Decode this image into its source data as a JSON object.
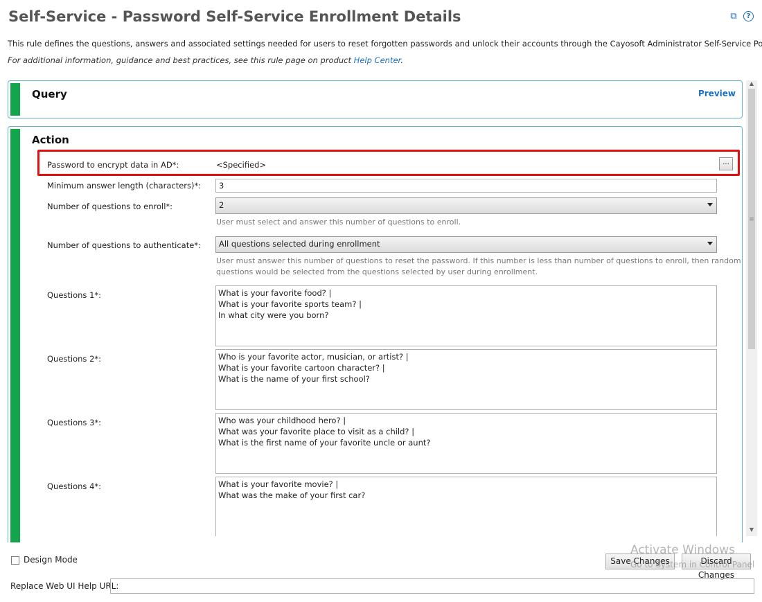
{
  "header": {
    "title": "Self-Service - Password Self-Service Enrollment Details",
    "copy_icon": "copy-icon",
    "help_icon": "help-icon",
    "description": "This rule defines the questions, answers and associated settings needed for users to reset forgotten passwords and unlock their accounts through the Cayosoft Administrator Self-Service Portal.",
    "help_prefix": "For additional information, guidance and best practices, see this rule page on product ",
    "help_link": "Help Center",
    "help_suffix": "."
  },
  "query": {
    "title": "Query",
    "preview_label": "Preview"
  },
  "action": {
    "title": "Action",
    "password_label": "Password to encrypt data in AD*:",
    "password_value": "<Specified>",
    "ellipsis_label": "...",
    "min_length_label": "Minimum answer length (characters)*:",
    "min_length_value": "3",
    "enroll_label": "Number of questions to enroll*:",
    "enroll_value": "2",
    "enroll_hint": "User must select and answer this number of questions to enroll.",
    "auth_label": "Number of questions to authenticate*:",
    "auth_value": "All questions selected during enrollment",
    "auth_hint_1": "User must answer this number of questions to reset the password. If this number is less than number of questions to enroll, then random",
    "auth_hint_2": "questions would be selected from the questions selected by user during enrollment.",
    "questions": [
      {
        "label": "Questions 1*:",
        "lines": [
          "What is your favorite food? |",
          "What is your favorite sports team? |",
          "In what city were you born?"
        ]
      },
      {
        "label": "Questions 2*:",
        "lines": [
          "Who is your favorite actor, musician, or artist? |",
          "What is your favorite cartoon character? |",
          "What is the name of your first school?"
        ]
      },
      {
        "label": "Questions 3*:",
        "lines": [
          "Who was your childhood hero? |",
          "What was your favorite place to visit as a child? |",
          "What is the first name of your favorite uncle or aunt?"
        ]
      },
      {
        "label": "Questions 4*:",
        "lines": [
          "What is your favorite movie? |",
          "What was the make of your first car?"
        ]
      }
    ]
  },
  "footer": {
    "design_mode_label": "Design Mode",
    "design_mode_checked": false,
    "save_label": "Save Changes",
    "discard_label": "Discard Changes",
    "watermark_title": "Activate Windows",
    "watermark_sub": "Go to System in Control Panel",
    "url_label": "Replace Web UI Help URL:",
    "url_value": ""
  },
  "colors": {
    "accent": "#1a6fc0",
    "green_bar": "#13a54b",
    "highlight": "#e01010",
    "panel_border": "#5fb3c4"
  }
}
